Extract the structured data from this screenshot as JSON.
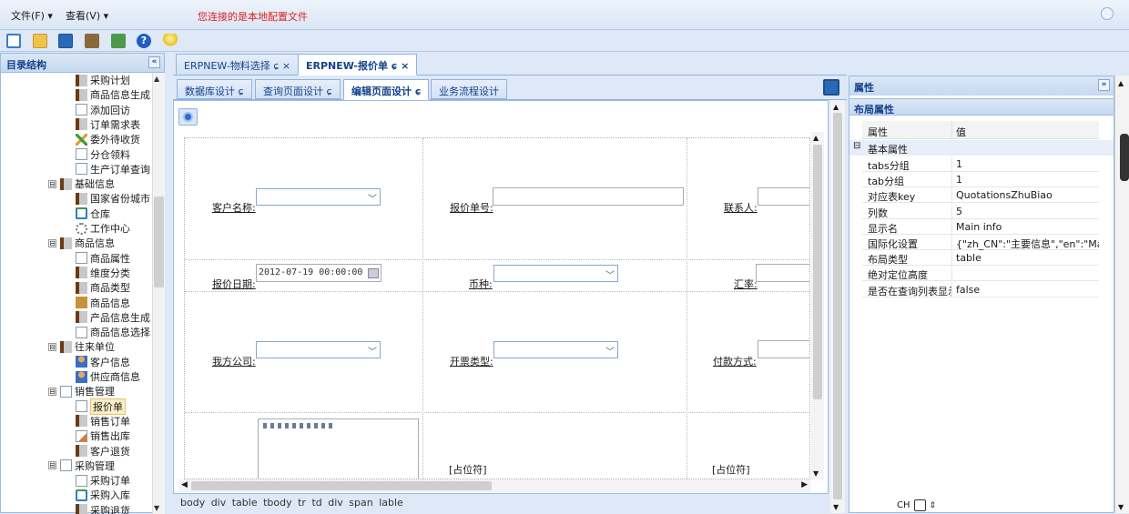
{
  "menubar": {
    "file": "文件(F)",
    "view": "查看(V)",
    "notice": "您连接的是本地配置文件"
  },
  "left": {
    "title": "目录结构",
    "collapse_glyph": "«",
    "tree": [
      {
        "label": "采购计划",
        "level": 3,
        "icon": "book-icon"
      },
      {
        "label": "商品信息生成",
        "level": 3,
        "icon": "book-icon"
      },
      {
        "label": "添加回访",
        "level": 3,
        "icon": "page-icon"
      },
      {
        "label": "订单需求表",
        "level": 3,
        "icon": "book-icon"
      },
      {
        "label": "委外待收货",
        "level": 3,
        "icon": "cross-icon"
      },
      {
        "label": "分仓领料",
        "level": 3,
        "icon": "page-icon"
      },
      {
        "label": "生产订单查询",
        "level": 3,
        "icon": "page-icon"
      },
      {
        "label": "基础信息",
        "level": 2,
        "icon": "book-icon",
        "toggle": "⊟"
      },
      {
        "label": "国家省份城市",
        "level": 3,
        "icon": "book-icon"
      },
      {
        "label": "仓库",
        "level": 3,
        "icon": "house-icon"
      },
      {
        "label": "工作中心",
        "level": 3,
        "icon": "gear-icon"
      },
      {
        "label": "商品信息",
        "level": 2,
        "icon": "book-icon",
        "toggle": "⊟"
      },
      {
        "label": "商品属性",
        "level": 3,
        "icon": "page-icon"
      },
      {
        "label": "维度分类",
        "level": 3,
        "icon": "book-icon"
      },
      {
        "label": "商品类型",
        "level": 3,
        "icon": "book-icon"
      },
      {
        "label": "商品信息",
        "level": 3,
        "icon": "box-icon"
      },
      {
        "label": "产品信息生成",
        "level": 3,
        "icon": "book-icon"
      },
      {
        "label": "商品信息选择",
        "level": 3,
        "icon": "page-icon"
      },
      {
        "label": "往来单位",
        "level": 2,
        "icon": "book-icon",
        "toggle": "⊟"
      },
      {
        "label": "客户信息",
        "level": 3,
        "icon": "user-icon"
      },
      {
        "label": "供应商信息",
        "level": 3,
        "icon": "user-icon"
      },
      {
        "label": "销售管理",
        "level": 2,
        "icon": "page-icon",
        "toggle": "⊟"
      },
      {
        "label": "报价单",
        "level": 3,
        "icon": "page-icon",
        "selected": true
      },
      {
        "label": "销售订单",
        "level": 3,
        "icon": "book-icon"
      },
      {
        "label": "销售出库",
        "level": 3,
        "icon": "edit-icon"
      },
      {
        "label": "客户退货",
        "level": 3,
        "icon": "book-icon"
      },
      {
        "label": "采购管理",
        "level": 2,
        "icon": "page-icon",
        "toggle": "⊟"
      },
      {
        "label": "采购订单",
        "level": 3,
        "icon": "page-icon"
      },
      {
        "label": "采购入库",
        "level": 3,
        "icon": "house-icon"
      },
      {
        "label": "采购退货",
        "level": 3,
        "icon": "book-icon"
      }
    ]
  },
  "doc_tabs": [
    {
      "label": "ERPNEW-物料选择 ɕ ×"
    },
    {
      "label": "ERPNEW-报价单 ɕ ×",
      "active": true
    }
  ],
  "sub_tabs": [
    {
      "label": "数据库设计 ɕ"
    },
    {
      "label": "查询页面设计 ɕ"
    },
    {
      "label": "编辑页面设计 ɕ",
      "active": true
    },
    {
      "label": "业务流程设计"
    }
  ],
  "form": {
    "customer_name": "客户名称:",
    "quote_no": "报价单号:",
    "contact": "联系人:",
    "quote_date": "报价日期:",
    "quote_date_value": "2012-07-19 00:00:00",
    "currency": "币种:",
    "exchange_rate": "汇率:",
    "our_company": "我方公司:",
    "invoice_type": "开票类型:",
    "payment_method": "付款方式:",
    "placeholder1": "[占位符]",
    "placeholder2": "[占位符]"
  },
  "path": "body div table tbody tr td div span lable",
  "right": {
    "title": "属性",
    "expand_glyph": "»",
    "subtitle": "布局属性",
    "col_key": "属性",
    "col_val": "值",
    "group": "基本属性",
    "group_toggle": "⊟",
    "rows": [
      {
        "k": "tabs分组",
        "v": "1"
      },
      {
        "k": "tab分组",
        "v": "1"
      },
      {
        "k": "对应表key",
        "v": "QuotationsZhuBiao"
      },
      {
        "k": "列数",
        "v": "5"
      },
      {
        "k": "显示名",
        "v": "Main info"
      },
      {
        "k": "国际化设置",
        "v": "{\"zh_CN\":\"主要信息\",\"en\":\"Main"
      },
      {
        "k": "布局类型",
        "v": "table"
      },
      {
        "k": "绝对定位高度",
        "v": ""
      },
      {
        "k": "是否在查询列表显示",
        "v": "false"
      }
    ]
  },
  "ime": {
    "label": "CH"
  },
  "colors": {
    "accent": "#15428b",
    "notice": "#e02020",
    "border": "#99bbe8"
  }
}
